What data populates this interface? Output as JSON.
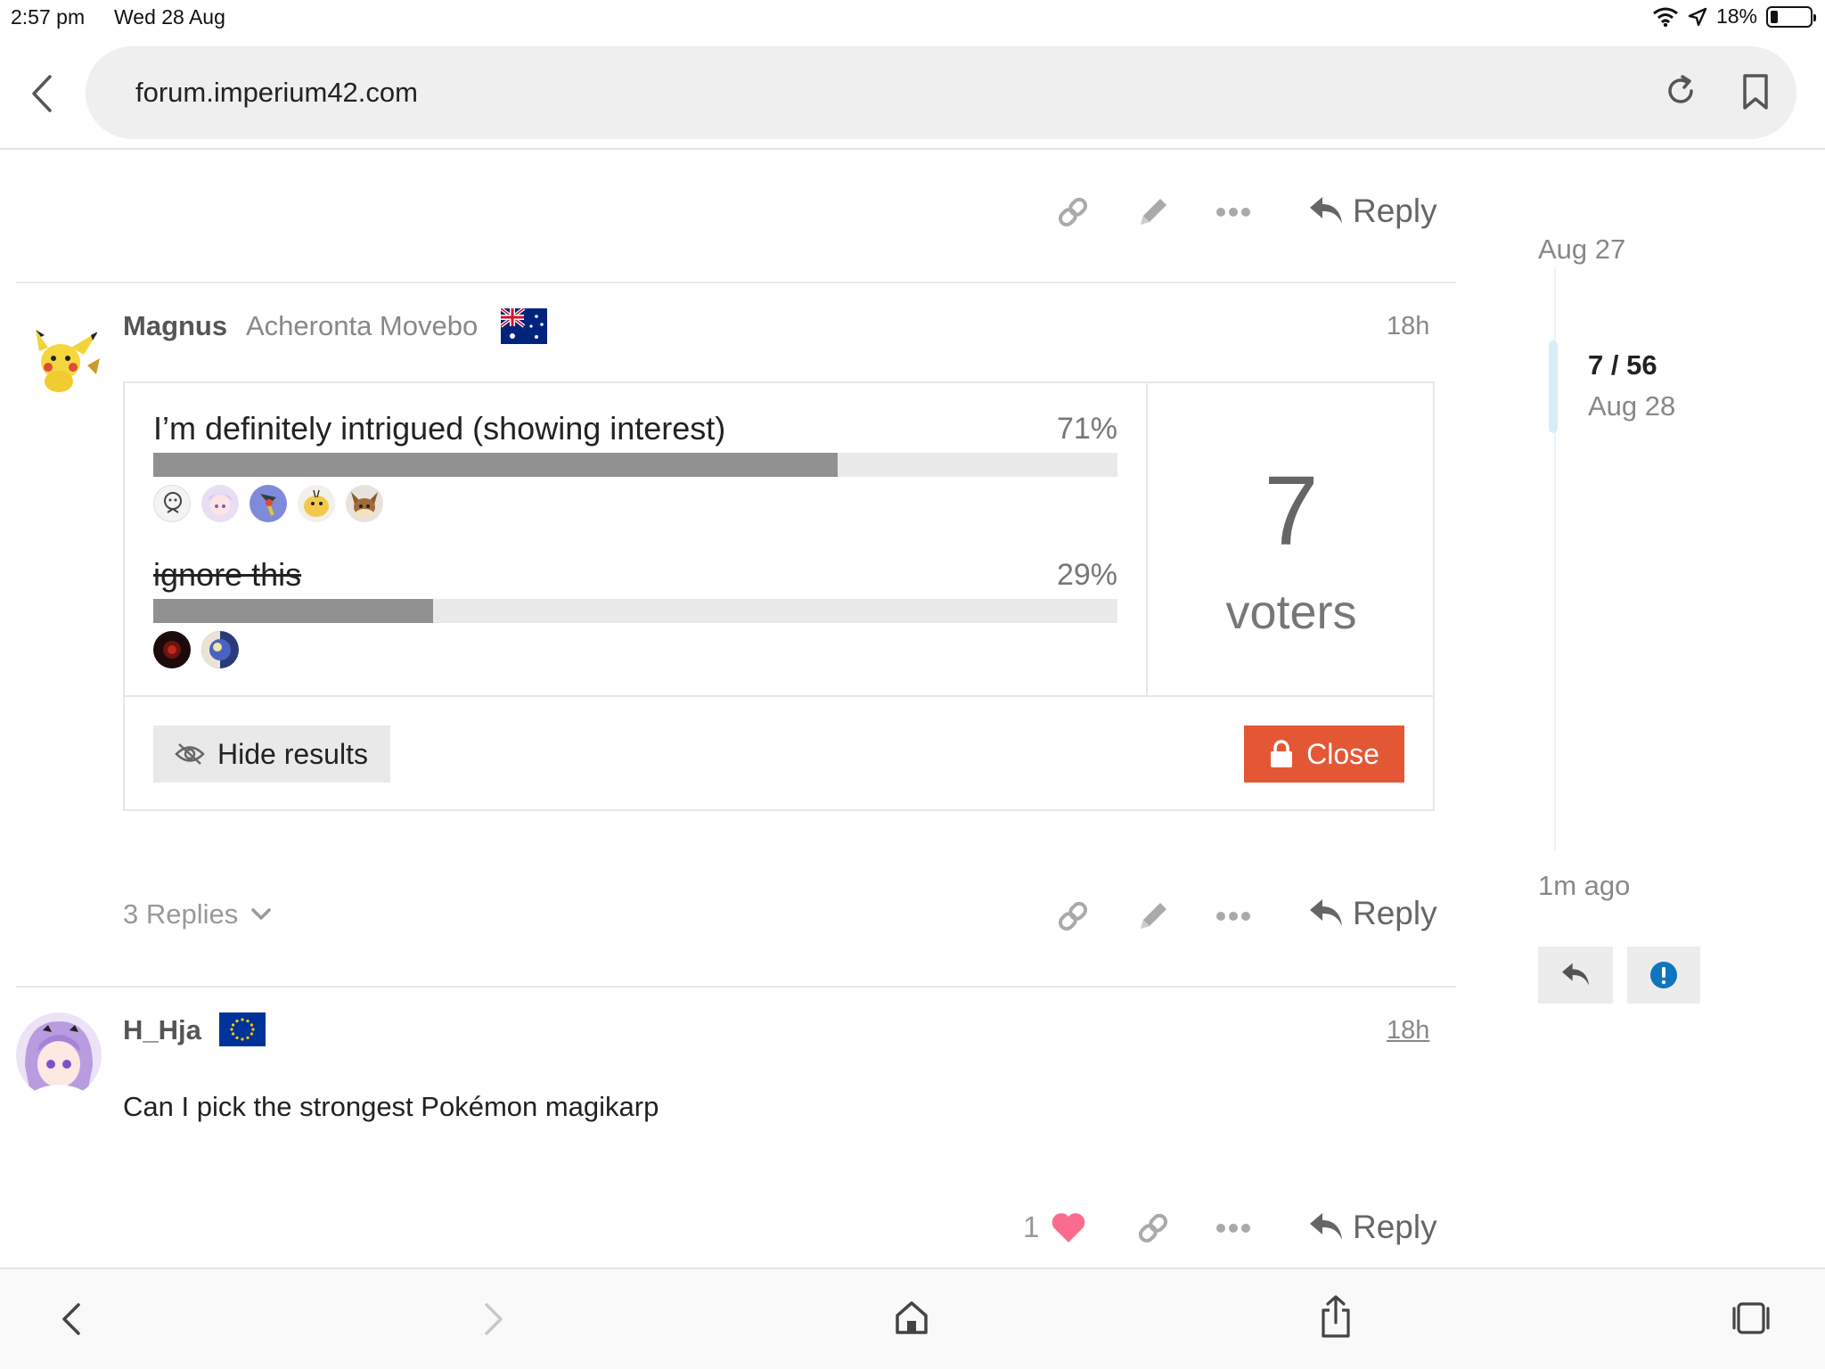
{
  "status_bar": {
    "time": "2:57 pm",
    "date": "Wed 28 Aug",
    "battery": "18%",
    "battery_level": 0.18
  },
  "browser": {
    "url": "forum.imperium42.com"
  },
  "post_actions": {
    "reply_label": "Reply"
  },
  "post1": {
    "username": "Magnus",
    "user_title": "Acheronta Movebo",
    "flag": "australia-flag",
    "time": "18h",
    "replies_label": "3 Replies",
    "poll": {
      "options": [
        {
          "label": "I’m definitely intrigued (showing interest)",
          "percent_label": "71%",
          "percent": 0.71,
          "voters": 5,
          "strikethrough": false
        },
        {
          "label": "ignore this",
          "percent_label": "29%",
          "percent": 0.29,
          "voters": 2,
          "strikethrough": true
        }
      ],
      "voters_count": "7",
      "voters_label": "voters",
      "hide_results_label": "Hide results",
      "close_label": "Close"
    }
  },
  "post2": {
    "username": "H_Hja",
    "flag": "eu-flag",
    "time": "18h",
    "body": "Can I pick the strongest Pokémon magikarp",
    "like_count": "1"
  },
  "timeline": {
    "top_date": "Aug 27",
    "position": "7 / 56",
    "position_date": "Aug 28",
    "bottom_date": "1m ago"
  },
  "colors": {
    "accent": "#e45735",
    "like": "#fa6c8d",
    "info": "#0e76bd",
    "bar_fill": "#919191",
    "bar_bg": "#e9e9e9"
  }
}
